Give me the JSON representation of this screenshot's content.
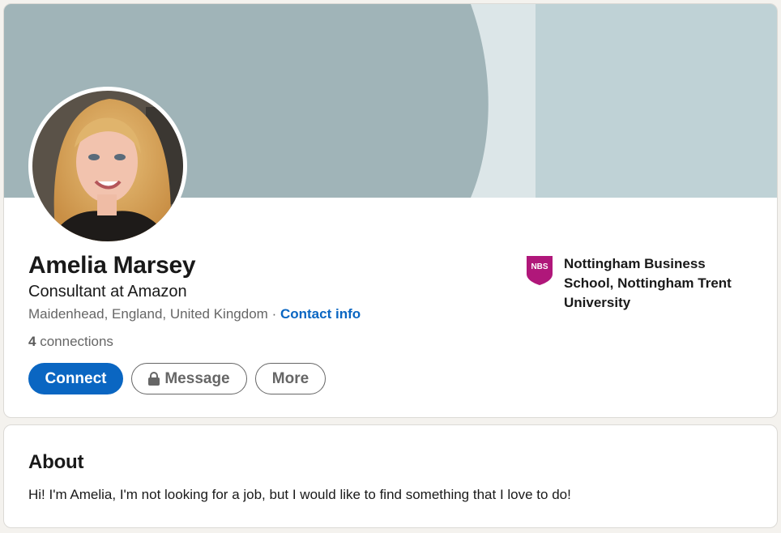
{
  "profile": {
    "name": "Amelia Marsey",
    "headline": "Consultant at Amazon",
    "location": "Maidenhead, England, United Kingdom",
    "separator": "·",
    "contact_link": "Contact info",
    "connections_count": "4",
    "connections_label": "connections",
    "avatar_icon": "profile-photo"
  },
  "actions": {
    "connect_label": "Connect",
    "message_label": "Message",
    "message_icon": "lock-icon",
    "more_label": "More"
  },
  "education": {
    "logo_text": "NBS",
    "school_name": "Nottingham Business School, Nottingham Trent University"
  },
  "about": {
    "title": "About",
    "text": "Hi! I'm Amelia, I'm not looking for a job, but I would like to find something that I love to do!"
  },
  "colors": {
    "accent": "#0a66c2",
    "banner_dark": "#a0b4b8",
    "banner_light": "#bfd2d6",
    "school_logo": "#b0177a"
  }
}
